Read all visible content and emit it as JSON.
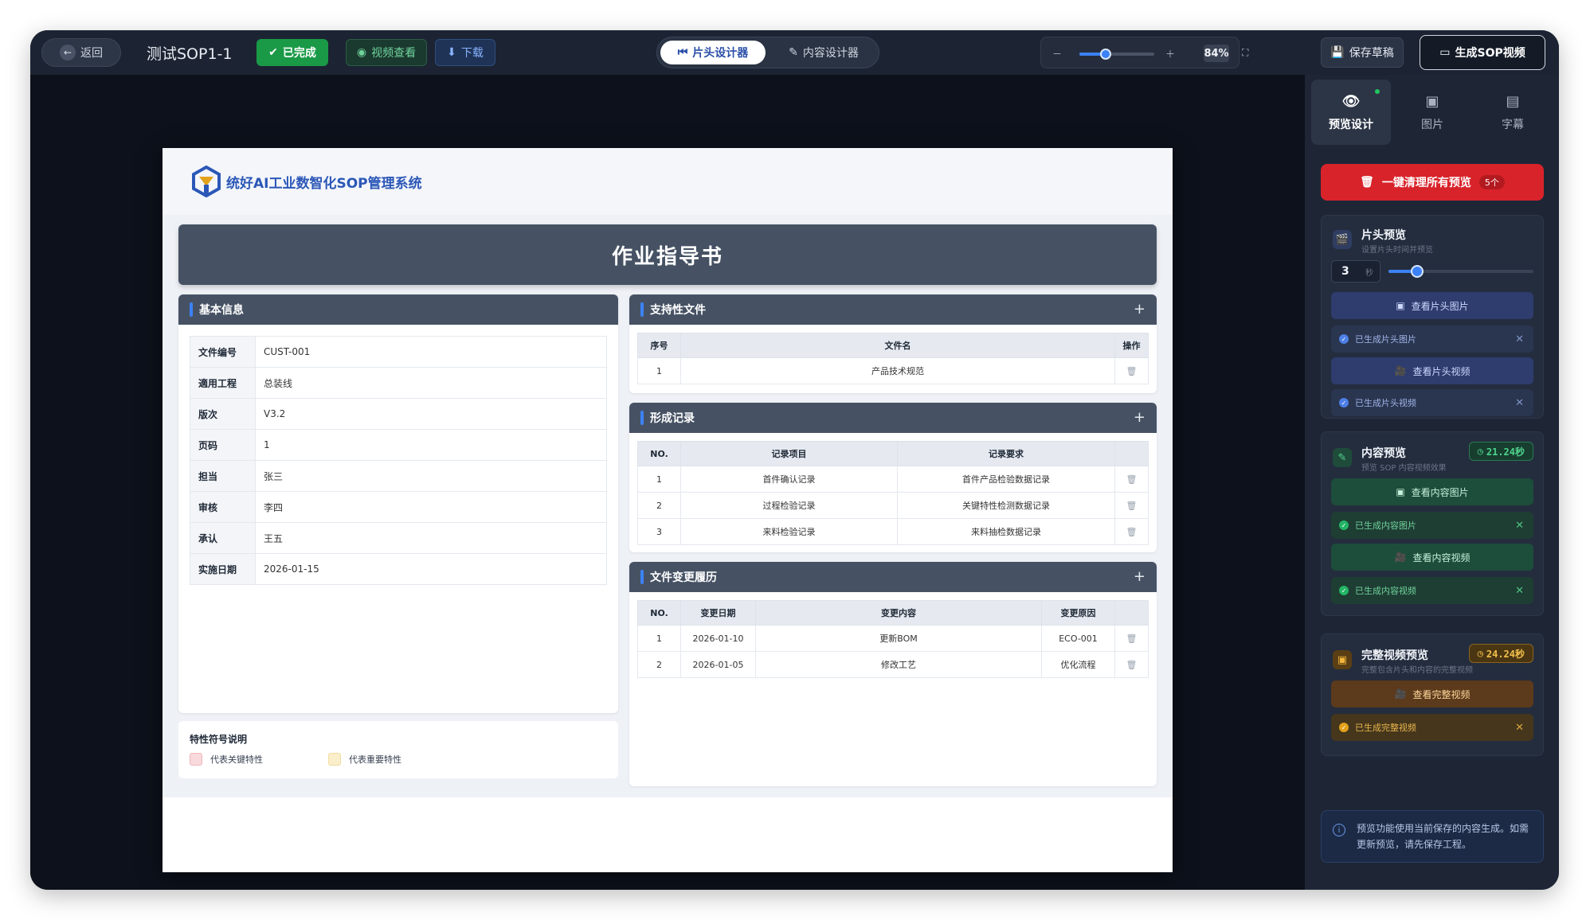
{
  "topbar": {
    "back_label": "返回",
    "project_title": "测试SOP1-1",
    "status_label": "已完成",
    "video_view_label": "视频查看",
    "download_label": "下载",
    "designer_tabs": [
      "片头设计器",
      "内容设计器"
    ],
    "zoom_percent": "84%",
    "zoom_level": 0.35,
    "save_draft_label": "保存草稿",
    "generate_label": "生成SOP视频"
  },
  "document": {
    "brand": "统好AI工业数智化SOP管理系统",
    "banner_title": "作业指导书",
    "basic_info": {
      "title": "基本信息",
      "rows": [
        {
          "key": "文件编号",
          "value": "CUST-001"
        },
        {
          "key": "適用工程",
          "value": "总装线"
        },
        {
          "key": "版次",
          "value": "V3.2"
        },
        {
          "key": "页码",
          "value": "1"
        },
        {
          "key": "担当",
          "value": "张三"
        },
        {
          "key": "审核",
          "value": "李四"
        },
        {
          "key": "承认",
          "value": "王五"
        },
        {
          "key": "实施日期",
          "value": "2026-01-15"
        }
      ]
    },
    "support_files": {
      "title": "支持性文件",
      "add": "+",
      "headers": [
        "序号",
        "文件名",
        "操作"
      ],
      "rows": [
        [
          "1",
          "产品技术规范"
        ]
      ]
    },
    "records": {
      "title": "形成记录",
      "add": "+",
      "headers": [
        "NO.",
        "记录项目",
        "记录要求",
        ""
      ],
      "rows": [
        [
          "1",
          "首件确认记录",
          "首件产品检验数据记录"
        ],
        [
          "2",
          "过程检验记录",
          "关键特性检测数据记录"
        ],
        [
          "3",
          "来料检验记录",
          "来料抽检数据记录"
        ]
      ]
    },
    "change_history": {
      "title": "文件变更履历",
      "add": "+",
      "headers": [
        "NO.",
        "变更日期",
        "变更内容",
        "变更原因",
        ""
      ],
      "rows": [
        [
          "1",
          "2026-01-10",
          "更新BOM",
          "ECO-001"
        ],
        [
          "2",
          "2026-01-05",
          "修改工艺",
          "优化流程"
        ]
      ]
    },
    "legend": {
      "title": "特性符号说明",
      "items": [
        {
          "label": "代表关键特性",
          "color": "#f8d9dc"
        },
        {
          "label": "代表重要特性",
          "color": "#fbeecb"
        }
      ]
    },
    "delete_glyph": "🗑"
  },
  "right_panel": {
    "tabs": [
      "预览设计",
      "图片",
      "字幕"
    ],
    "clear_label": "一键清理所有预览",
    "clear_count": "5个",
    "header_preview": {
      "title": "片头预览",
      "subtitle": "设置片头时间并预览",
      "duration_value": "3",
      "duration_unit": "秒",
      "duration_level": 0.2,
      "view_image_label": "查看片头图片",
      "image_done_label": "已生成片头图片",
      "view_video_label": "查看片头视频",
      "video_done_label": "已生成片头视频"
    },
    "content_preview": {
      "title": "内容预览",
      "subtitle": "预览 SOP 内容视频效果",
      "duration_badge": "21.24秒",
      "view_image_label": "查看内容图片",
      "image_done_label": "已生成内容图片",
      "view_video_label": "查看内容视频",
      "video_done_label": "已生成内容视频"
    },
    "full_preview": {
      "title": "完整视频预览",
      "subtitle": "完整包含片头和内容的完整视频",
      "duration_badge": "24.24秒",
      "view_video_label": "查看完整视频",
      "video_done_label": "已生成完整视频"
    },
    "info_text": "预览功能使用当前保存的内容生成。如需更新预览，请先保存工程。"
  },
  "colors": {
    "accent_blue": "#3b82f6",
    "success_green": "#1a9a47",
    "danger_red": "#d8232a",
    "warn_gold": "#e3a21a",
    "header_slate": "#465264"
  }
}
